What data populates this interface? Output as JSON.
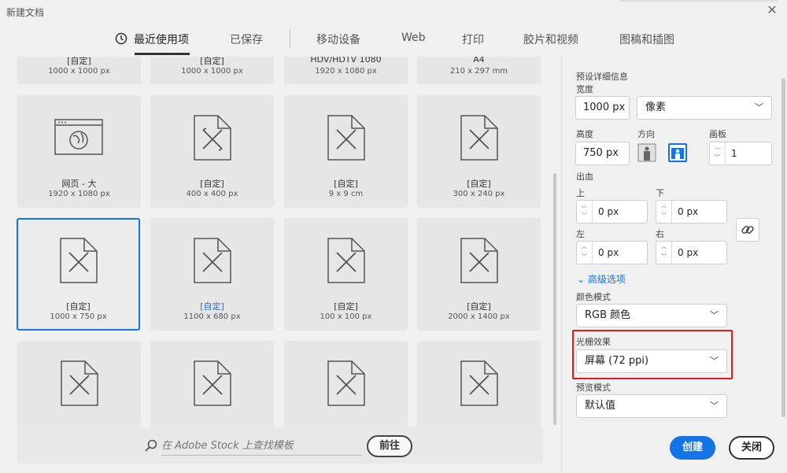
{
  "window": {
    "title": "新建文档"
  },
  "tabs": [
    {
      "label": "最近使用项",
      "active": true
    },
    {
      "label": "已保存"
    },
    {
      "label": "移动设备"
    },
    {
      "label": "Web"
    },
    {
      "label": "打印"
    },
    {
      "label": "胶片和视频"
    },
    {
      "label": "图稿和插图"
    }
  ],
  "presets_top": [
    {
      "name": "[自定]",
      "size": "1000 x 1000 px"
    },
    {
      "name": "[自定]",
      "size": "1000 x 1000 px"
    },
    {
      "name": "HDV/HDTV 1080",
      "size": "1920 x 1080 px"
    },
    {
      "name": "A4",
      "size": "210 x 297 mm"
    }
  ],
  "presets_row2": [
    {
      "name": "网页 - 大",
      "size": "1920 x 1080 px",
      "icon": "web-page-icon"
    },
    {
      "name": "[自定]",
      "size": "400 x 400 px"
    },
    {
      "name": "[自定]",
      "size": "9 x 9 cm"
    },
    {
      "name": "[自定]",
      "size": "300 x 240 px"
    }
  ],
  "presets_row3": [
    {
      "name": "[自定]",
      "size": "1000 x 750 px",
      "selected": true
    },
    {
      "name": "[自定]",
      "size": "1100 x 680 px",
      "highlight": true
    },
    {
      "name": "[自定]",
      "size": "100 x 100 px"
    },
    {
      "name": "[自定]",
      "size": "2000 x 1400 px"
    }
  ],
  "search": {
    "placeholder": "在 Adobe Stock 上查找模板",
    "go_label": "前往"
  },
  "details": {
    "section_title": "预设详细信息",
    "width_label": "宽度",
    "width_value": "1000 px",
    "unit_value": "像素",
    "height_label": "高度",
    "height_value": "750 px",
    "orientation_label": "方向",
    "artboard_label": "画板",
    "artboard_value": "1",
    "bleed_label": "出血",
    "top_label": "上",
    "top_value": "0 px",
    "bottom_label": "下",
    "bottom_value": "0 px",
    "left_label": "左",
    "left_value": "0 px",
    "right_label": "右",
    "right_value": "0 px",
    "advanced_label": "高级选项",
    "color_mode_label": "颜色模式",
    "color_mode_value": "RGB 颜色",
    "raster_label": "光栅效果",
    "raster_value": "屏幕 (72 ppi)",
    "preview_label": "预览模式",
    "preview_value": "默认值"
  },
  "actions": {
    "create_label": "创建",
    "close_label": "关闭"
  },
  "colors": {
    "accent": "#1473e6",
    "highlight_box": "#e81919"
  }
}
